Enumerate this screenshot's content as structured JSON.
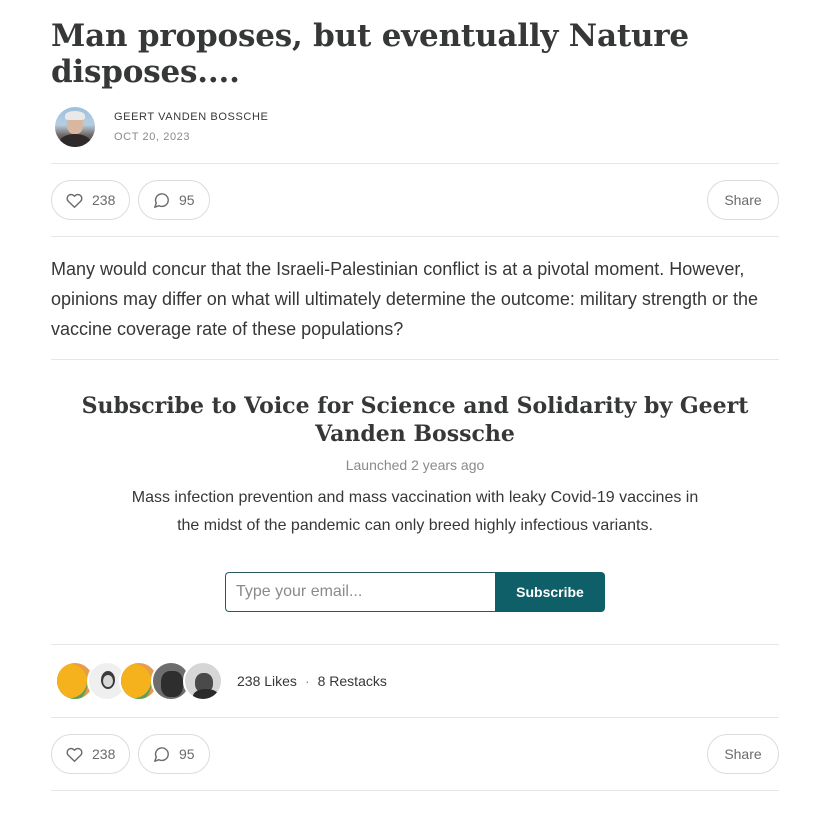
{
  "post": {
    "title": "Man proposes, but eventually Nature disposes....",
    "author": "GEERT VANDEN BOSSCHE",
    "date": "OCT 20, 2023",
    "body": "Many would concur that the Israeli-Palestinian conflict is at a pivotal moment. However, opinions may differ on what will ultimately determine the outcome: military strength or the vaccine coverage rate of these populations?"
  },
  "actions_top": {
    "likes": "238",
    "comments": "95",
    "share": "Share"
  },
  "subscribe": {
    "title": "Subscribe to Voice for Science and Solidarity by Geert Vanden Bossche",
    "launched": "Launched 2 years ago",
    "description": "Mass infection prevention and mass vaccination with leaky Covid-19 vaccines in the midst of the pandemic can only breed highly infectious variants.",
    "email_placeholder": "Type your email...",
    "button": "Subscribe"
  },
  "reactions": {
    "likes_label": "238 Likes",
    "separator": "·",
    "restacks_label": "8 Restacks"
  },
  "actions_bottom": {
    "likes": "238",
    "comments": "95",
    "share": "Share"
  },
  "colors": {
    "accent": "#0f5f68",
    "text": "#363737",
    "muted": "#8a8a8a"
  },
  "icons": [
    "heart-icon",
    "comment-icon"
  ]
}
